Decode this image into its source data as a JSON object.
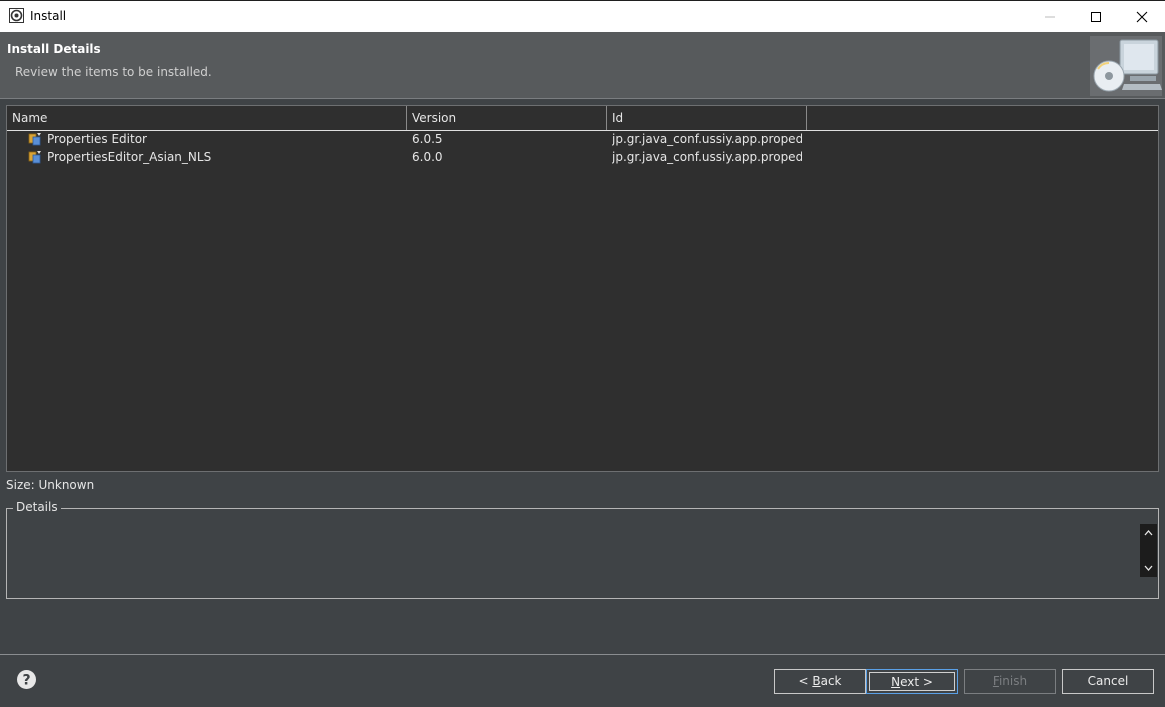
{
  "window": {
    "title": "Install",
    "minimize_icon": "minimize-icon",
    "maximize_icon": "maximize-icon",
    "close_icon": "close-icon"
  },
  "header": {
    "title": "Install Details",
    "subtitle": "Review the items to be installed.",
    "image_icon": "install-wizard-icon"
  },
  "table": {
    "columns": [
      "Name",
      "Version",
      "Id",
      ""
    ],
    "rows": [
      {
        "name": "Properties Editor",
        "version": "6.0.5",
        "id": "jp.gr.java_conf.ussiy.app.propedit....",
        "icon": "feature-icon"
      },
      {
        "name": "PropertiesEditor_Asian_NLS",
        "version": "6.0.0",
        "id": "jp.gr.java_conf.ussiy.app.propedit....",
        "icon": "feature-icon"
      }
    ]
  },
  "size_label": "Size: Unknown",
  "details": {
    "legend": "Details",
    "text": ""
  },
  "footer": {
    "help_icon": "help-icon",
    "back_pre": "< ",
    "back_mn": "B",
    "back_post": "ack",
    "next_mn": "N",
    "next_post": "ext >",
    "finish_mn": "F",
    "finish_post": "inish",
    "cancel": "Cancel"
  },
  "colors": {
    "background": "#3f4346",
    "banner": "#575a5c",
    "table_bg": "#2f2f2f",
    "default_button_border": "#5aa0e6"
  }
}
